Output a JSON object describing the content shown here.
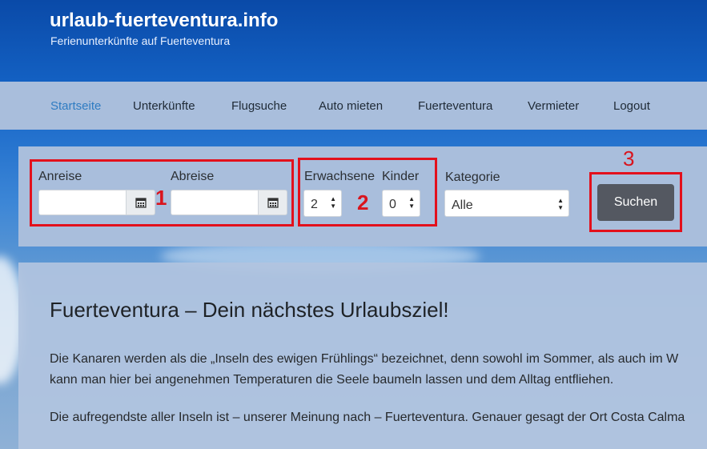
{
  "site": {
    "title": "urlaub-fuerteventura.info",
    "subtitle": "Ferienunterkünfte auf Fuerteventura"
  },
  "nav": {
    "items": [
      {
        "label": "Startseite",
        "active": true
      },
      {
        "label": "Unterkünfte"
      },
      {
        "label": "Flugsuche"
      },
      {
        "label": "Auto mieten"
      },
      {
        "label": "Fuerteventura"
      },
      {
        "label": "Vermieter"
      },
      {
        "label": "Logout"
      }
    ]
  },
  "search": {
    "anreise_label": "Anreise",
    "abreise_label": "Abreise",
    "anreise_value": "",
    "abreise_value": "",
    "erwachsene_label": "Erwachsene",
    "erwachsene_value": "2",
    "kinder_label": "Kinder",
    "kinder_value": "0",
    "kategorie_label": "Kategorie",
    "kategorie_value": "Alle",
    "button_label": "Suchen"
  },
  "annotations": {
    "marker_1": "1",
    "marker_2": "2",
    "marker_3": "3",
    "color": "#e3101c"
  },
  "content": {
    "title": "Fuerteventura – Dein nächstes Urlaubsziel!",
    "para1_line1": "Die Kanaren werden als die „Inseln des ewigen Frühlings“ bezeichnet, denn sowohl im Sommer, als auch im W",
    "para1_line2": "kann man hier bei angenehmen Temperaturen die Seele baumeln lassen und dem Alltag entfliehen.",
    "para2_line1": "Die aufregendste aller Inseln ist – unserer Meinung nach – Fuerteventura. Genauer gesagt der Ort Costa Calma"
  },
  "colors": {
    "navbar_bg": "#a9bedc",
    "accent": "#2f7cc2",
    "button_bg": "#545861"
  }
}
